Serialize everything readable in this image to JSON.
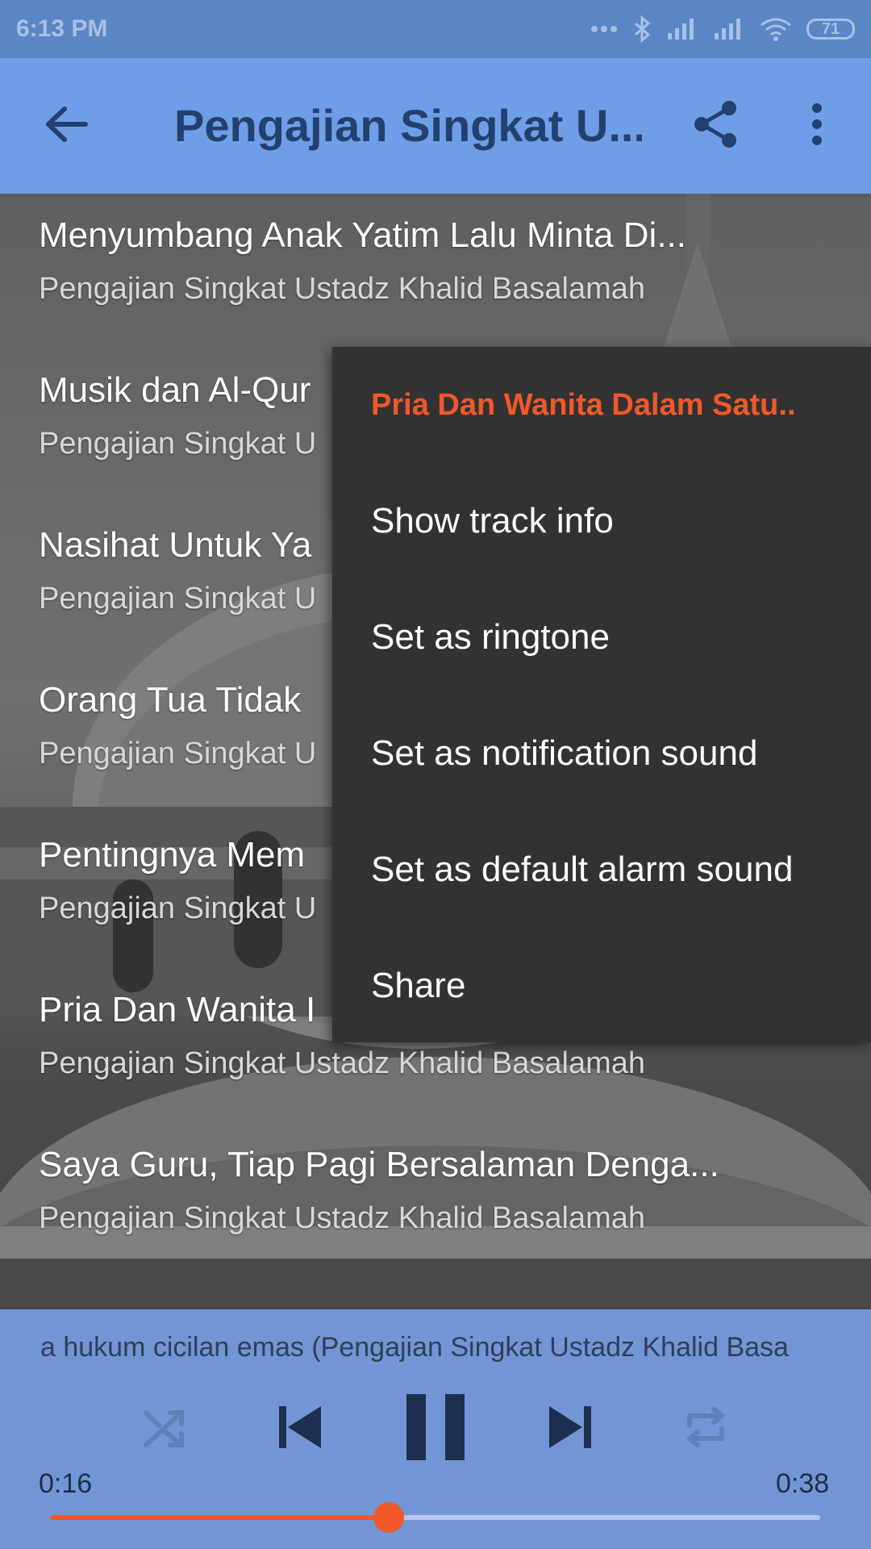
{
  "status_bar": {
    "time": "6:13 PM",
    "battery": "71",
    "icons": [
      "more-dots-icon",
      "bluetooth-icon",
      "signal-icon",
      "signal-icon",
      "wifi-icon",
      "battery-icon"
    ]
  },
  "toolbar": {
    "title": "Pengajian Singkat U...",
    "back_icon": "back-arrow-icon",
    "share_icon": "share-icon",
    "more_icon": "more-vert-icon"
  },
  "tracks": [
    {
      "title": "Menyumbang Anak Yatim Lalu Minta Di...",
      "subtitle": "Pengajian Singkat Ustadz Khalid Basalamah"
    },
    {
      "title": "Musik dan Al-Qur",
      "subtitle": "Pengajian Singkat U"
    },
    {
      "title": "Nasihat Untuk Ya",
      "subtitle": "Pengajian Singkat U"
    },
    {
      "title": "Orang Tua Tidak",
      "subtitle": "Pengajian Singkat U"
    },
    {
      "title": "Pentingnya Mem",
      "subtitle": "Pengajian Singkat U"
    },
    {
      "title": "Pria Dan Wanita I",
      "subtitle": "Pengajian Singkat Ustadz Khalid Basalamah"
    },
    {
      "title": "Saya Guru, Tiap Pagi Bersalaman Denga...",
      "subtitle": "Pengajian Singkat Ustadz Khalid Basalamah"
    }
  ],
  "context_menu": {
    "header": "Pria Dan Wanita Dalam Satu..",
    "items": [
      "Show track info",
      "Set as ringtone",
      "Set as notification sound",
      "Set as default alarm sound",
      "Share"
    ]
  },
  "player": {
    "now_playing": "a hukum cicilan emas (Pengajian Singkat Ustadz Khalid Basa",
    "elapsed": "0:16",
    "duration": "0:38",
    "progress": 0.44,
    "accent_color": "#f0582a",
    "controls": [
      "shuffle-icon",
      "skip-previous-icon",
      "pause-icon",
      "skip-next-icon",
      "repeat-icon"
    ]
  }
}
